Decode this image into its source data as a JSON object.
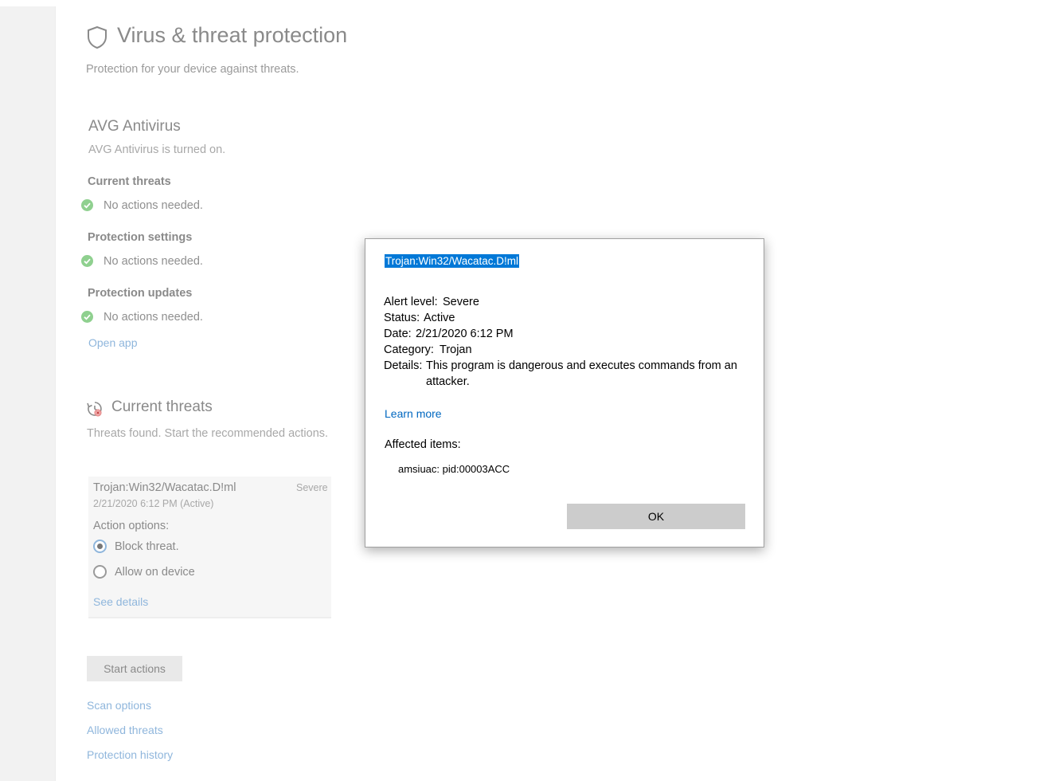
{
  "page": {
    "title": "Virus & threat protection",
    "subtitle": "Protection for your device against threats."
  },
  "provider": {
    "name": "AVG Antivirus",
    "status": "AVG Antivirus is turned on.",
    "groups": [
      {
        "title": "Current threats",
        "status": "No actions needed."
      },
      {
        "title": "Protection settings",
        "status": "No actions needed."
      },
      {
        "title": "Protection updates",
        "status": "No actions needed."
      }
    ],
    "open_app": "Open app"
  },
  "threats": {
    "title": "Current threats",
    "subtitle": "Threats found. Start the recommended actions.",
    "card": {
      "name": "Trojan:Win32/Wacatac.D!ml",
      "severity": "Severe",
      "date": "2/21/2020 6:12 PM (Active)",
      "action_label": "Action options:",
      "options": [
        {
          "label": "Block threat.",
          "selected": true
        },
        {
          "label": "Allow on device",
          "selected": false
        }
      ],
      "see_details": "See details"
    },
    "start_actions": "Start actions"
  },
  "links": {
    "scan_options": "Scan options",
    "allowed_threats": "Allowed threats",
    "protection_history": "Protection history"
  },
  "dialog": {
    "title": "Trojan:Win32/Wacatac.D!ml",
    "alert_label": "Alert level:",
    "alert_value": "Severe",
    "status_label": "Status:",
    "status_value": "Active",
    "date_label": "Date:",
    "date_value": "2/21/2020 6:12 PM",
    "category_label": "Category:",
    "category_value": "Trojan",
    "details_label": "Details:",
    "details_line1": "This program is dangerous and executes commands from an",
    "details_line2": "attacker.",
    "learn_more": "Learn more",
    "affected_label": "Affected items:",
    "affected_item": "amsiuac: pid:00003ACC",
    "ok": "OK"
  },
  "colors": {
    "accent": "#0078d7",
    "link": "#0067c0",
    "ok_green": "#2e9c2e"
  }
}
